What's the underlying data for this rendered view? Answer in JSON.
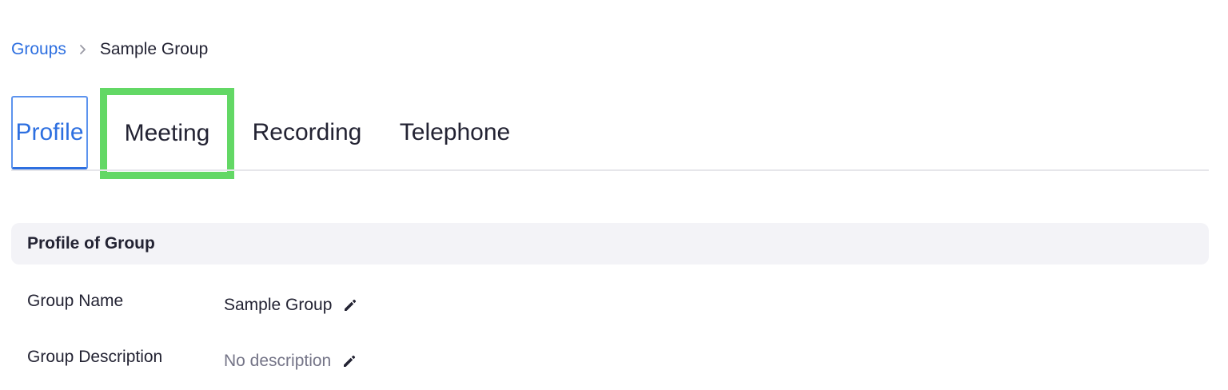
{
  "breadcrumb": {
    "parent": "Groups",
    "separator_icon": "chevron-right-icon",
    "current": "Sample Group"
  },
  "tabs": [
    {
      "label": "Profile",
      "active": true
    },
    {
      "label": "Meeting",
      "highlighted": true
    },
    {
      "label": "Recording"
    },
    {
      "label": "Telephone"
    }
  ],
  "colors": {
    "accent": "#2d6fe0",
    "highlight_box": "#63d865",
    "section_bg": "#f3f3f7",
    "text": "#232333",
    "muted_text": "#747487"
  },
  "section": {
    "title": "Profile of Group",
    "rows": [
      {
        "label": "Group Name",
        "value": "Sample Group",
        "icon": "pencil-icon"
      },
      {
        "label": "Group Description",
        "value": "No description",
        "icon": "pencil-icon"
      }
    ]
  }
}
